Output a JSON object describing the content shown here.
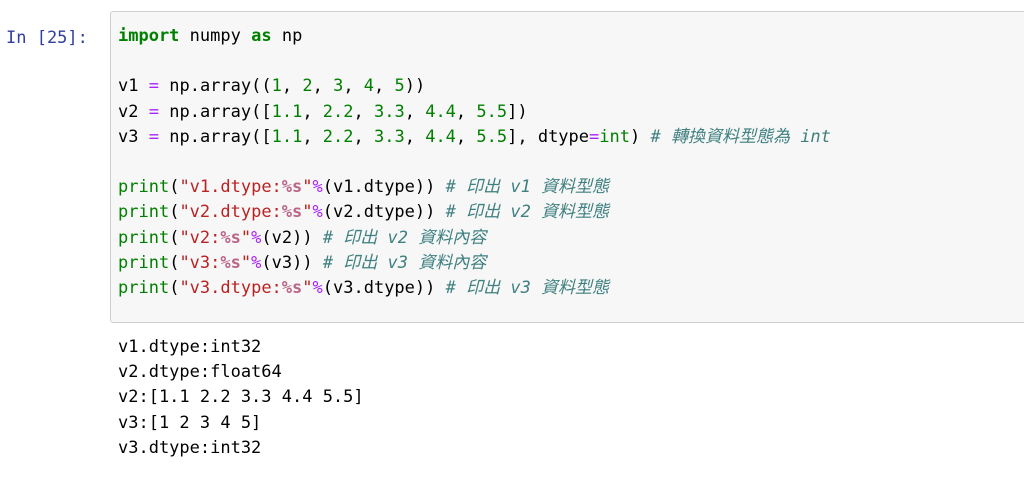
{
  "prompt": "In [25]:",
  "code": {
    "import": {
      "kw1": "import",
      "mod": "numpy",
      "kw2": "as",
      "alias": "np"
    },
    "v1": {
      "name": "v1",
      "eq": "=",
      "call": "np.array((",
      "n1": "1",
      "n2": "2",
      "n3": "3",
      "n4": "4",
      "n5": "5",
      "close": "))"
    },
    "v2": {
      "name": "v2",
      "eq": "=",
      "call": "np.array([",
      "n1": "1.1",
      "n2": "2.2",
      "n3": "3.3",
      "n4": "4.4",
      "n5": "5.5",
      "close": "])"
    },
    "v3": {
      "name": "v3",
      "eq": "=",
      "call": "np.array([",
      "n1": "1.1",
      "n2": "2.2",
      "n3": "3.3",
      "n4": "4.4",
      "n5": "5.5",
      "close": "], dtype",
      "eq2": "=",
      "type": "int",
      "close2": ")",
      "comment": "# 轉換資料型態為 int"
    },
    "p1": {
      "fn": "print",
      "open": "(",
      "s1": "\"v1.dtype:",
      "si": "%s",
      "s2": "\"",
      "op": "%",
      "arg": "(v1.dtype))",
      "comment": "# 印出 v1 資料型態"
    },
    "p2": {
      "fn": "print",
      "open": "(",
      "s1": "\"v2.dtype:",
      "si": "%s",
      "s2": "\"",
      "op": "%",
      "arg": "(v2.dtype))",
      "comment": "# 印出 v2 資料型態"
    },
    "p3": {
      "fn": "print",
      "open": "(",
      "s1": "\"v2:",
      "si": "%s",
      "s2": "\"",
      "op": "%",
      "arg": "(v2))",
      "comment": "# 印出 v2 資料內容"
    },
    "p4": {
      "fn": "print",
      "open": "(",
      "s1": "\"v3:",
      "si": "%s",
      "s2": "\"",
      "op": "%",
      "arg": "(v3))",
      "comment": "# 印出 v3 資料內容"
    },
    "p5": {
      "fn": "print",
      "open": "(",
      "s1": "\"v3.dtype:",
      "si": "%s",
      "s2": "\"",
      "op": "%",
      "arg": "(v3.dtype))",
      "comment": "# 印出 v3 資料型態"
    }
  },
  "output": [
    "v1.dtype:int32",
    "v2.dtype:float64",
    "v2:[1.1 2.2 3.3 4.4 5.5]",
    "v3:[1 2 3 4 5]",
    "v3.dtype:int32"
  ],
  "colors": {
    "prompt": "#303f9f",
    "keyword": "#008000",
    "operator": "#aa22ff",
    "string": "#ba2121",
    "comment": "#408080",
    "cell_bg": "#f7f7f7"
  }
}
